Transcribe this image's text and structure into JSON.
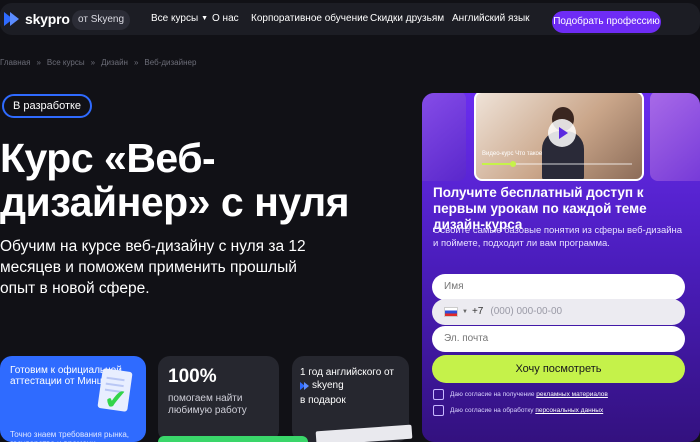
{
  "header": {
    "logo_text": "skypro",
    "from_badge": "от Skyeng",
    "nav": [
      {
        "label": "Все курсы",
        "has_dropdown": true
      },
      {
        "label": "О нас"
      },
      {
        "label": "Корпоративное обучение"
      },
      {
        "label": "Скидки друзьям"
      },
      {
        "label": "Английский язык"
      }
    ],
    "cta_label": "Подобрать профессию"
  },
  "breadcrumbs": [
    "Главная",
    "Все курсы",
    "Дизайн",
    "Веб-дизайнер"
  ],
  "badge": "В разработке",
  "hero": {
    "title": "Курс «Веб-дизайнер» с нуля",
    "lead": "Обучим на курсе веб-дизайну с нуля за 12 месяцев и поможем применить прошлый опыт в новой сфере."
  },
  "cards": {
    "attestation": {
      "title": "Готовим к официальной аттестации от Минцифры",
      "subtitle": "Точно знаем требования рынка, государства и времени."
    },
    "job": {
      "big": "100%",
      "text": "помогаем найти любимую работу"
    },
    "english": {
      "pre": "1 год английского от",
      "brand": "skyeng",
      "post": "в подарок"
    }
  },
  "panel": {
    "video_caption": "Видео-курс  Что такое",
    "video_progress": 0.2,
    "heading": "Получите бесплатный доступ к первым урокам по каждой теме дизайн-курса",
    "description": "Освоите самые базовые понятия из сферы веб-дизайна и поймете, подходит ли вам программа.",
    "name_placeholder": "Имя",
    "phone_code": "+7",
    "phone_placeholder": "(000) 000-00-00",
    "email_placeholder": "Эл. почта",
    "submit_label": "Хочу посмотреть",
    "consent_ads_prefix": "Даю согласие на получение",
    "consent_ads_link": "рекламных материалов",
    "consent_data_prefix": "Даю согласие на обработку",
    "consent_data_link": "персональных данных"
  },
  "colors": {
    "accent": "#6e2cf5",
    "brand_blue": "#2f6bff",
    "lime": "#c5f24a",
    "background": "#111116"
  }
}
